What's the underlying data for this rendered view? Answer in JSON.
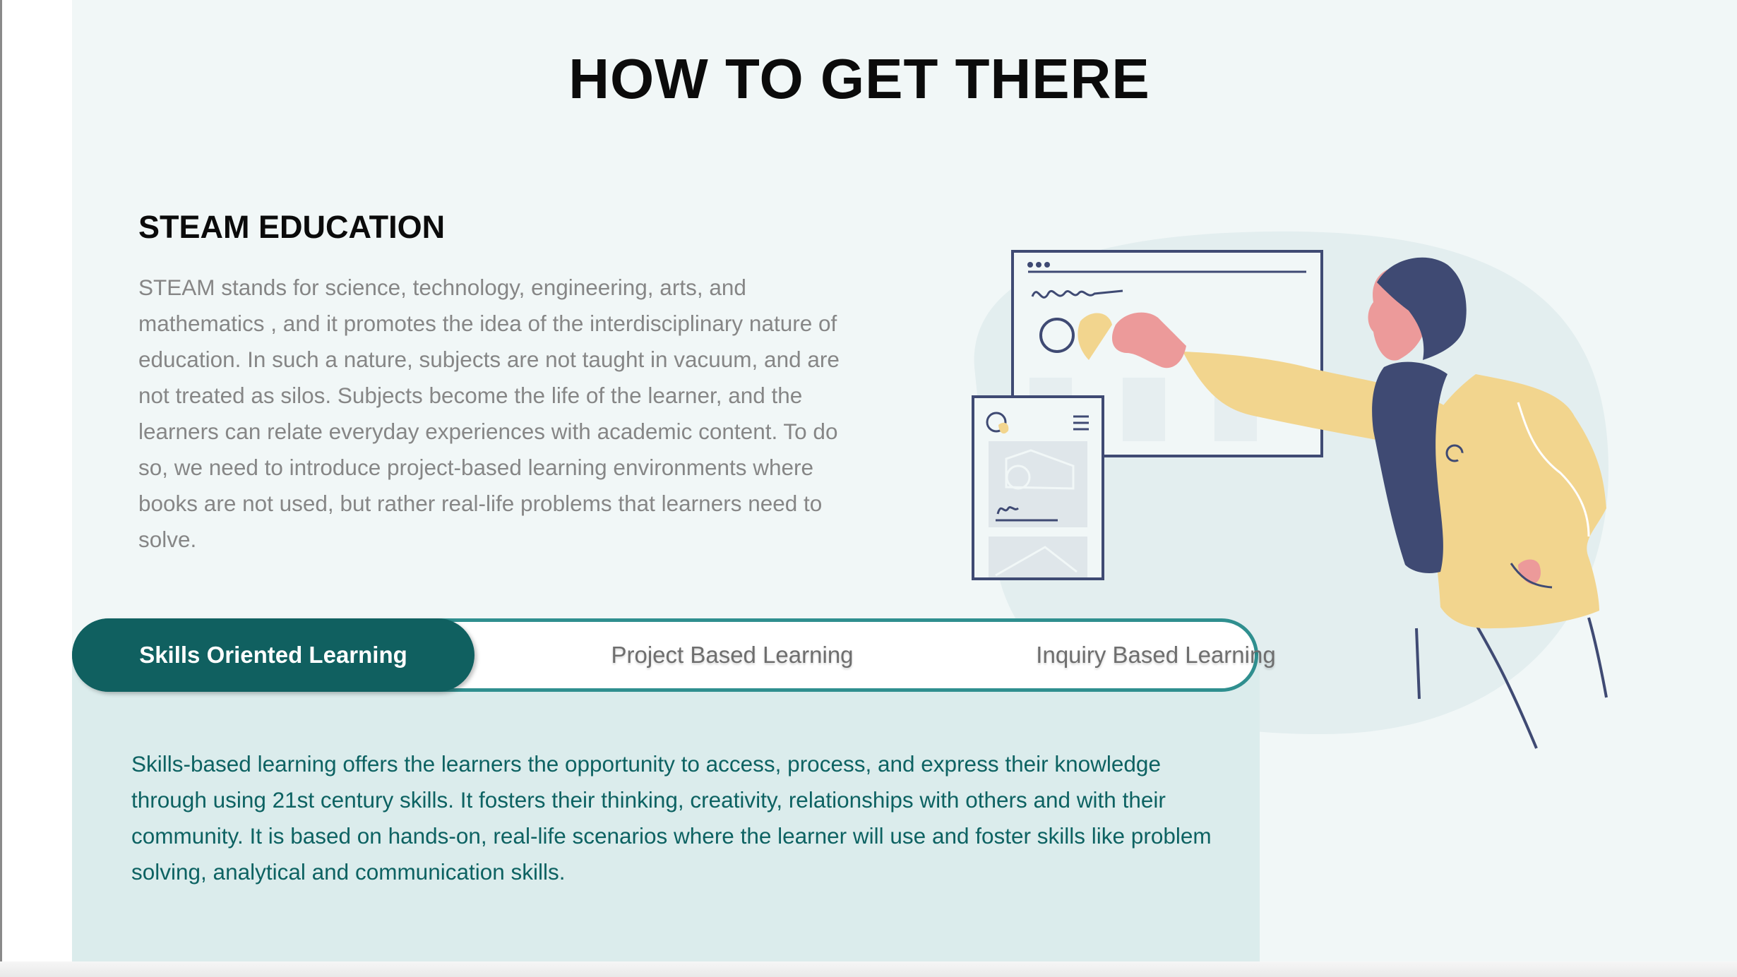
{
  "page": {
    "title": "HOW TO GET THERE"
  },
  "steam": {
    "heading": "STEAM EDUCATION",
    "body": "STEAM stands for  science, technology, engineering, arts,  and mathematics , and it promotes the idea of the  interdisciplinary nature  of education. In such a nature, subjects are not taught in vacuum, and are not treated as silos. Subjects become the life of the learner, and the learners can relate everyday experiences with academic content. To do so, we need to introduce project-based learning  environments where books are not used, but rather real-life problems that learners need to solve."
  },
  "tabs": {
    "items": [
      {
        "label": "Skills Oriented Learning",
        "active": true
      },
      {
        "label": "Project Based Learning",
        "active": false
      },
      {
        "label": "Inquiry Based Learning",
        "active": false
      }
    ]
  },
  "panel": {
    "text": "Skills-based learning offers the learners the opportunity to access, process, and express their knowledge through using 21st century skills. It fosters their thinking, creativity, relationships with others and with their community. It is based on hands-on, real-life scenarios where the learner will use and foster skills like problem solving, analytical and communication skills."
  },
  "colors": {
    "section_bg": "#f1f7f7",
    "tab_active_bg": "#106060",
    "tab_border": "#2f8f8f",
    "panel_bg": "#dbecec",
    "panel_text": "#0d6262",
    "body_text": "#868686",
    "illustration_navy": "#3f4a73",
    "illustration_yellow": "#f2d58e",
    "illustration_pink": "#ec9a9a"
  },
  "illustration": {
    "icon": "woman-pointing-at-screen-illustration"
  }
}
